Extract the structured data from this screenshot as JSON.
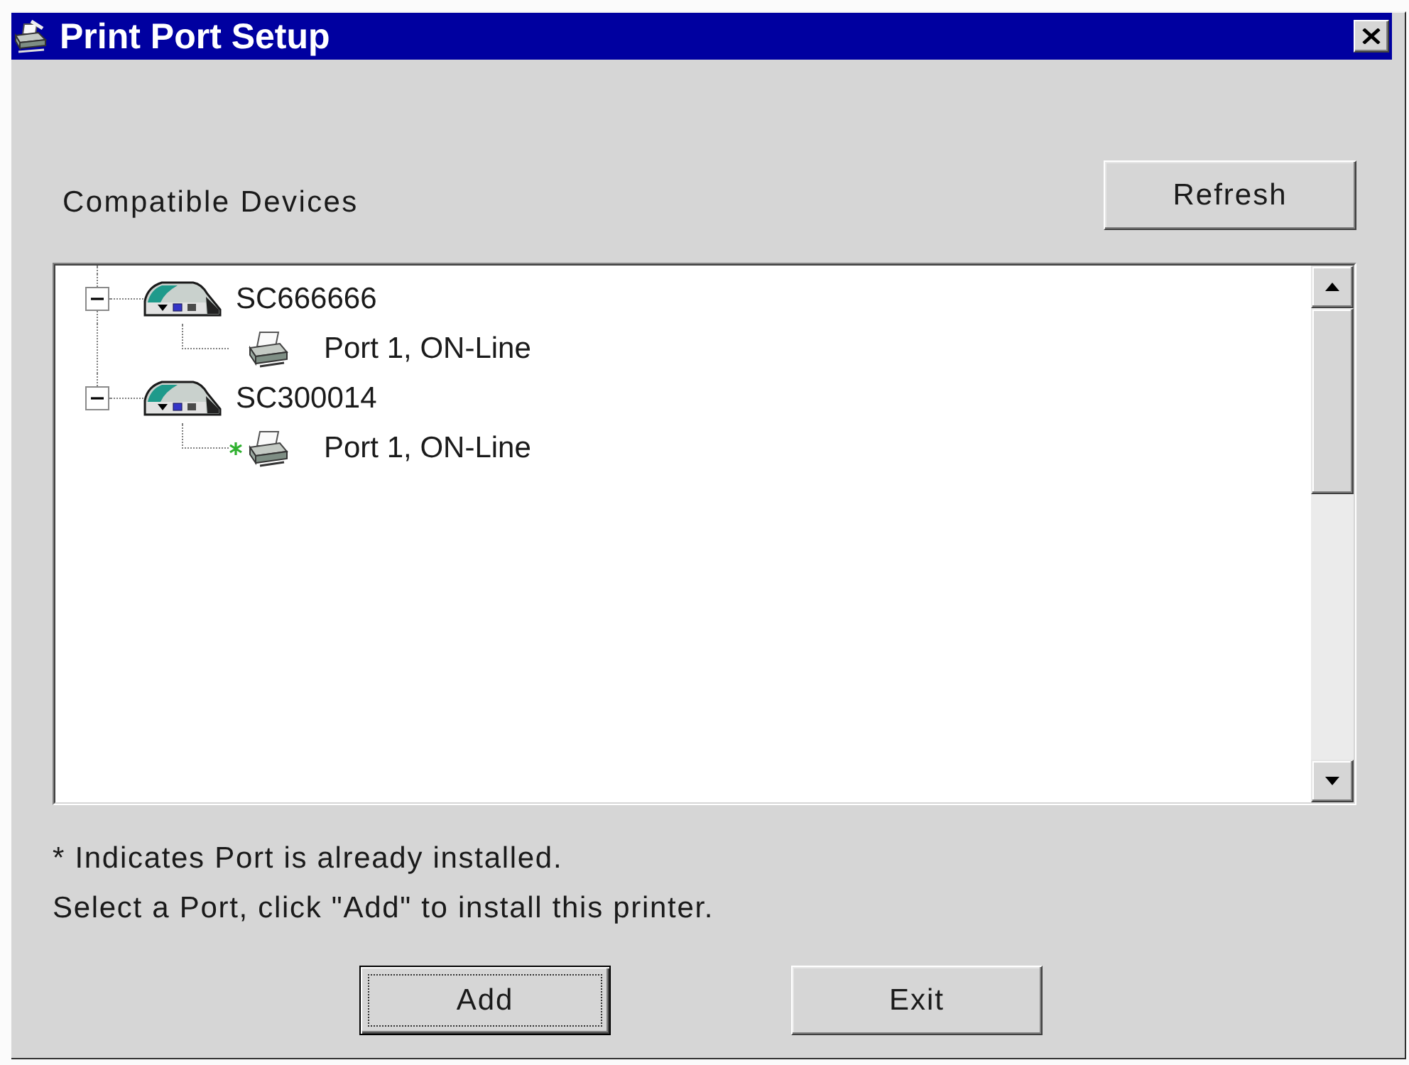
{
  "window": {
    "title": "Print Port Setup"
  },
  "devices_label": "Compatible Devices",
  "refresh_button": "Refresh",
  "tree": [
    {
      "label": "SC666666",
      "expanded": true,
      "children": [
        {
          "label": "Port 1, ON-Line",
          "installed": false
        }
      ]
    },
    {
      "label": "SC300014",
      "expanded": true,
      "children": [
        {
          "label": "Port 1, ON-Line",
          "installed": true
        }
      ]
    }
  ],
  "legend": "* Indicates Port is already installed.",
  "instruction": "Select a Port, click \"Add\" to install this printer.",
  "buttons": [
    {
      "label": "Add",
      "focused": true
    },
    {
      "label": "Exit",
      "focused": false
    }
  ]
}
